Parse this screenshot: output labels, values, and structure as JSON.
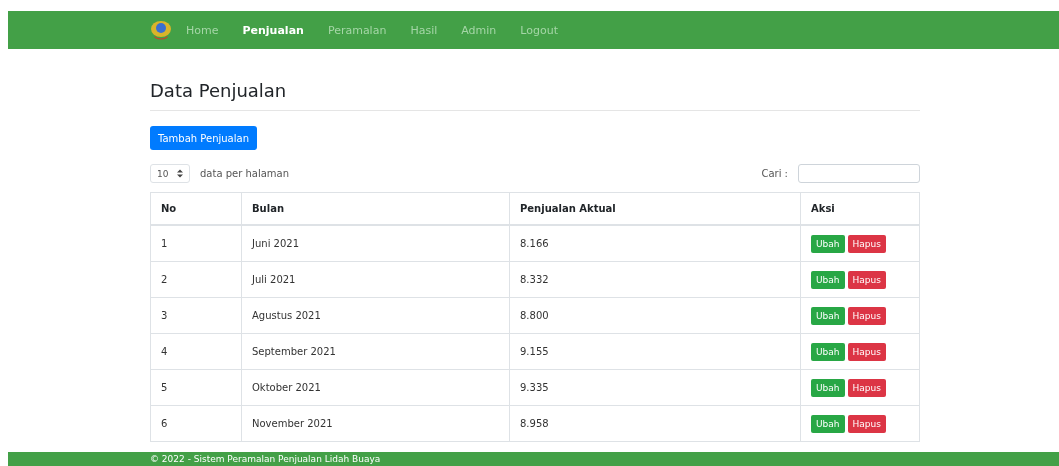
{
  "navbar": {
    "items": [
      {
        "label": "Home",
        "selected": false
      },
      {
        "label": "Penjualan",
        "selected": true
      },
      {
        "label": "Peramalan",
        "selected": false
      },
      {
        "label": "Hasil",
        "selected": false
      },
      {
        "label": "Admin",
        "selected": false
      },
      {
        "label": "Logout",
        "selected": false
      }
    ]
  },
  "title": "Data Penjualan",
  "add_button": "Tambah Penjualan",
  "page_size": {
    "value": "10",
    "label": "data per halaman"
  },
  "search": {
    "label": "Cari :"
  },
  "table": {
    "columns": [
      "No",
      "Bulan",
      "Penjualan Aktual",
      "Aksi"
    ],
    "rows": [
      {
        "no": "1",
        "bulan": "Juni 2021",
        "aktual": "8.166",
        "edit": "Ubah",
        "delete": "Hapus"
      },
      {
        "no": "2",
        "bulan": "Juli 2021",
        "aktual": "8.332",
        "edit": "Ubah",
        "delete": "Hapus"
      },
      {
        "no": "3",
        "bulan": "Agustus 2021",
        "aktual": "8.800",
        "edit": "Ubah",
        "delete": "Hapus"
      },
      {
        "no": "4",
        "bulan": "September 2021",
        "aktual": "9.155",
        "edit": "Ubah",
        "delete": "Hapus"
      },
      {
        "no": "5",
        "bulan": "Oktober 2021",
        "aktual": "9.335",
        "edit": "Ubah",
        "delete": "Hapus"
      },
      {
        "no": "6",
        "bulan": "November 2021",
        "aktual": "8.958",
        "edit": "Ubah",
        "delete": "Hapus"
      }
    ]
  },
  "footer": "© 2022 - Sistem Peramalan Penjualan Lidah Buaya"
}
